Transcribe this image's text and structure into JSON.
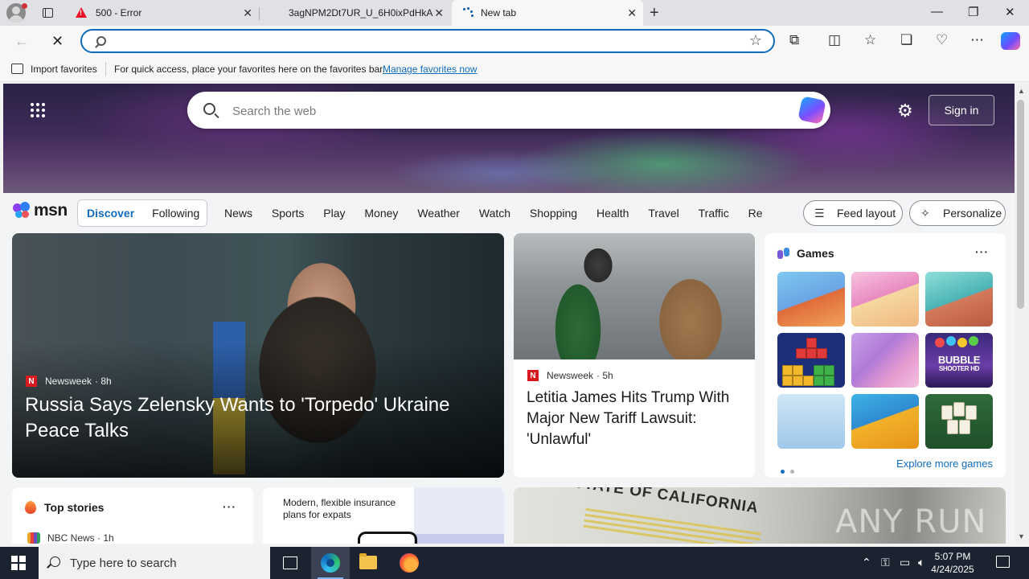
{
  "browser": {
    "tabs": [
      {
        "title": "500 - Error",
        "favicon": "error-icon",
        "active": false
      },
      {
        "title": "3agNPM2Dt7UR_U_6H0ixPdHkA...",
        "favicon": "none",
        "active": false
      },
      {
        "title": "New tab",
        "favicon": "loading-icon",
        "active": true
      }
    ],
    "address": {
      "value": "",
      "placeholder": ""
    },
    "favorites_bar": {
      "import_label": "Import favorites",
      "message": "For quick access, place your favorites here on the favorites bar.",
      "manage_link": "Manage favorites now"
    }
  },
  "msn": {
    "search_placeholder": "Search the web",
    "sign_in": "Sign in",
    "logo_text": "msn",
    "feed_tabs": [
      "Discover",
      "Following"
    ],
    "nav_links": [
      "News",
      "Sports",
      "Play",
      "Money",
      "Weather",
      "Watch",
      "Shopping",
      "Health",
      "Travel",
      "Traffic",
      "Real E"
    ],
    "feed_layout": "Feed layout",
    "personalize": "Personalize",
    "main_story": {
      "source": "Newsweek",
      "age": "· 8h",
      "headline": "Russia Says Zelensky Wants to 'Torpedo' Ukraine Peace Talks"
    },
    "second_story": {
      "source": "Newsweek",
      "age": "· 5h",
      "headline": "Letitia James Hits Trump With Major New Tariff Lawsuit: 'Unlawful'"
    },
    "games": {
      "title": "Games",
      "more": "···",
      "bubble_shooter_title": "BUBBLE",
      "bubble_shooter_sub": "SHOOTER HD",
      "explore": "Explore more games"
    },
    "top_stories": {
      "title": "Top stories",
      "more": "···",
      "source": "NBC News · 1h"
    },
    "ad": {
      "text": "Modern, flexible insurance plans for expats"
    },
    "california": {
      "sign_text": "STATE OF CALIFORNIA",
      "watermark": "ANY RUN"
    }
  },
  "taskbar": {
    "search_placeholder": "Type here to search",
    "time": "5:07 PM",
    "date": "4/24/2025"
  },
  "colors": {
    "accent": "#0f6cbd",
    "newsweek": "#d71920",
    "taskbar": "#1b2230"
  }
}
